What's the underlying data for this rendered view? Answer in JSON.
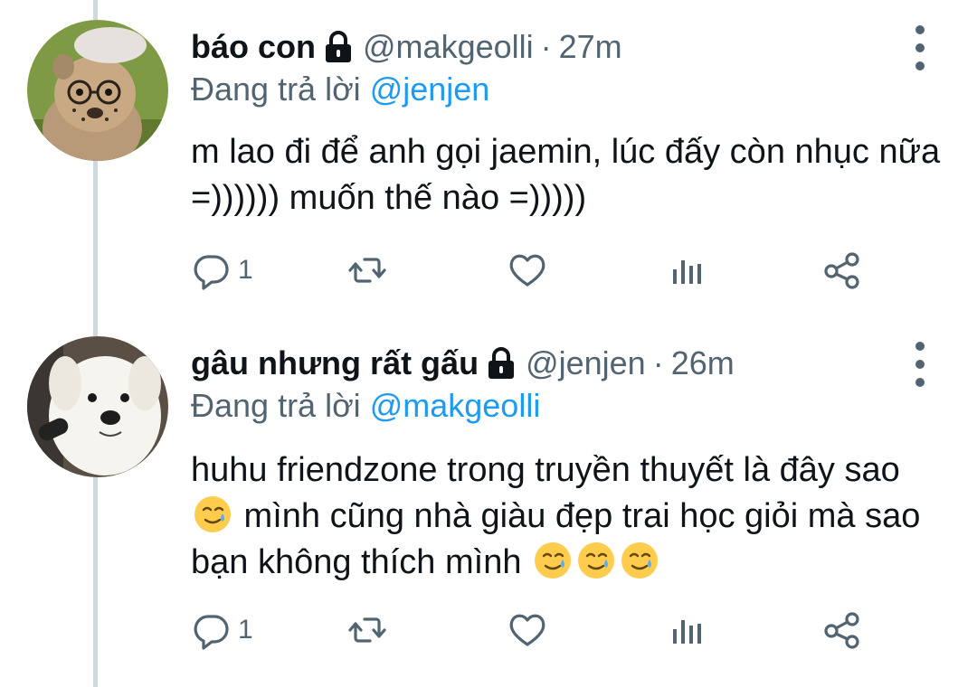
{
  "tweets": [
    {
      "name": "báo con",
      "handle": "@makgeolli",
      "separator": "·",
      "time": "27m",
      "replying_prefix": "Đang trả lời",
      "replying_to": "@jenjen",
      "text": "m lao đi để anh gọi jaemin, lúc đấy còn nhục nữa =)))))) muốn thế nào =)))))",
      "reply_count": "1",
      "avatar_icon": "cheetah-cub-with-glasses-avatar"
    },
    {
      "name": "gâu nhưng rất gấu",
      "handle": "@jenjen",
      "separator": "·",
      "time": "26m",
      "replying_prefix": "Đang trả lời",
      "replying_to": "@makgeolli",
      "text_line1": "huhu friendzone trong truyền thuyết là đây sao ",
      "text_line2": " mình cũng nhà giàu đẹp trai học giỏi mà sao bạn không thích mình ",
      "reply_count": "1",
      "avatar_icon": "white-dog-avatar"
    }
  ],
  "icons": {
    "lock": "lock-icon",
    "reply": "reply-icon",
    "retweet": "retweet-icon",
    "like": "heart-icon",
    "stats": "analytics-icon",
    "share": "share-icon",
    "more": "more-vertical-icon",
    "emoji": "smiling-face-with-tear"
  },
  "colors": {
    "link": "#1d9bf0",
    "secondary_text": "#536471",
    "thread_line": "#cfd9de"
  }
}
